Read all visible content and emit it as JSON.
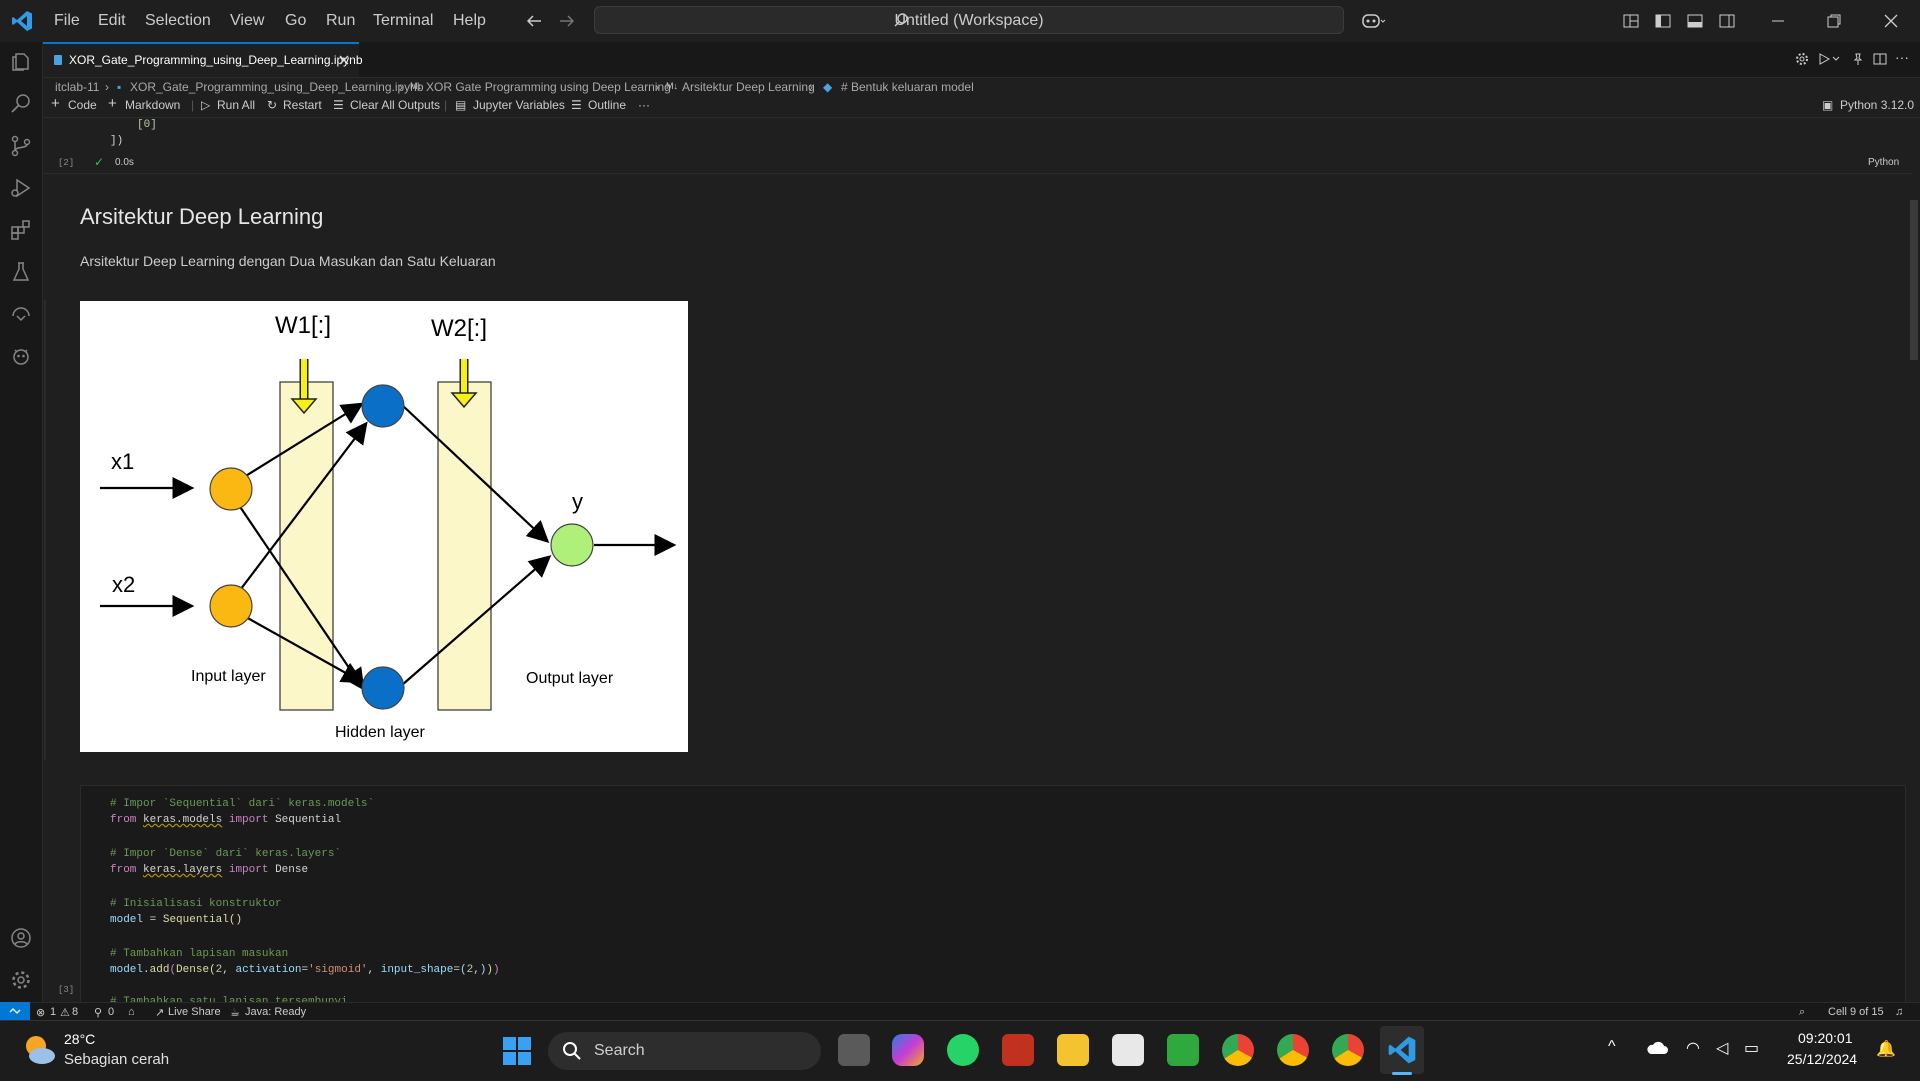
{
  "menu": [
    "File",
    "Edit",
    "Selection",
    "View",
    "Go",
    "Run",
    "Terminal",
    "Help"
  ],
  "command_center": "Untitled (Workspace)",
  "tab": {
    "label": "XOR_Gate_Programming_using_Deep_Learning.ipynb"
  },
  "breadcrumb": [
    "itclab-11",
    "XOR_Gate_Programming_using_Deep_Learning.ipynb",
    "XOR Gate Programming using Deep Learning",
    "Arsitektur Deep Learning",
    "# Bentuk keluaran model"
  ],
  "toolbar": {
    "code": "Code",
    "markdown": "Markdown",
    "run_all": "Run All",
    "restart": "Restart",
    "clear_outputs": "Clear All Outputs",
    "jupyter_vars": "Jupyter Variables",
    "outline": "Outline",
    "more": "···",
    "kernel": "Python 3.12.0"
  },
  "prev_cell": {
    "output_line1": "[0]",
    "output_line2": "])",
    "exec_count": "[2]",
    "time": "0.0s",
    "lang": "Python"
  },
  "markdown": {
    "heading": "Arsitektur Deep Learning",
    "paragraph": "Arsitektur Deep Learning dengan Dua Masukan dan Satu Keluaran"
  },
  "diagram": {
    "w1": "W1[:]",
    "w2": "W2[:]",
    "x1": "x1",
    "x2": "x2",
    "y": "y",
    "input_layer": "Input layer",
    "hidden_layer": "Hidden layer",
    "output_layer": "Output layer",
    "colors": {
      "input": "#fbb813",
      "hidden": "#0a6fc6",
      "output": "#aef07a",
      "weights": "#fbf7c8",
      "arrow": "#f5ef1a"
    }
  },
  "code_cell": {
    "exec_count": "[3]",
    "lines": [
      "# Impor `Sequential` dari` keras.models`",
      "from keras.models import Sequential",
      "",
      "# Impor `Dense` dari` keras.layers`",
      "from keras.layers import Dense",
      "",
      "# Inisialisasi konstruktor",
      "model = Sequential()",
      "",
      "# Tambahkan lapisan masukan",
      "model.add(Dense(2, activation='sigmoid', input_shape=(2,)))",
      "",
      "# Tambahkan satu lapisan tersembunyi"
    ]
  },
  "status": {
    "errors": "1",
    "warnings": "8",
    "ports": "0",
    "live_share": "Live Share",
    "java": "Java: Ready",
    "cell_pos": "Cell 9 of 15"
  },
  "taskbar": {
    "weather_temp": "28°C",
    "weather_desc": "Sebagian cerah",
    "search": "Search",
    "time": "09:20:01",
    "date": "25/12/2024"
  }
}
